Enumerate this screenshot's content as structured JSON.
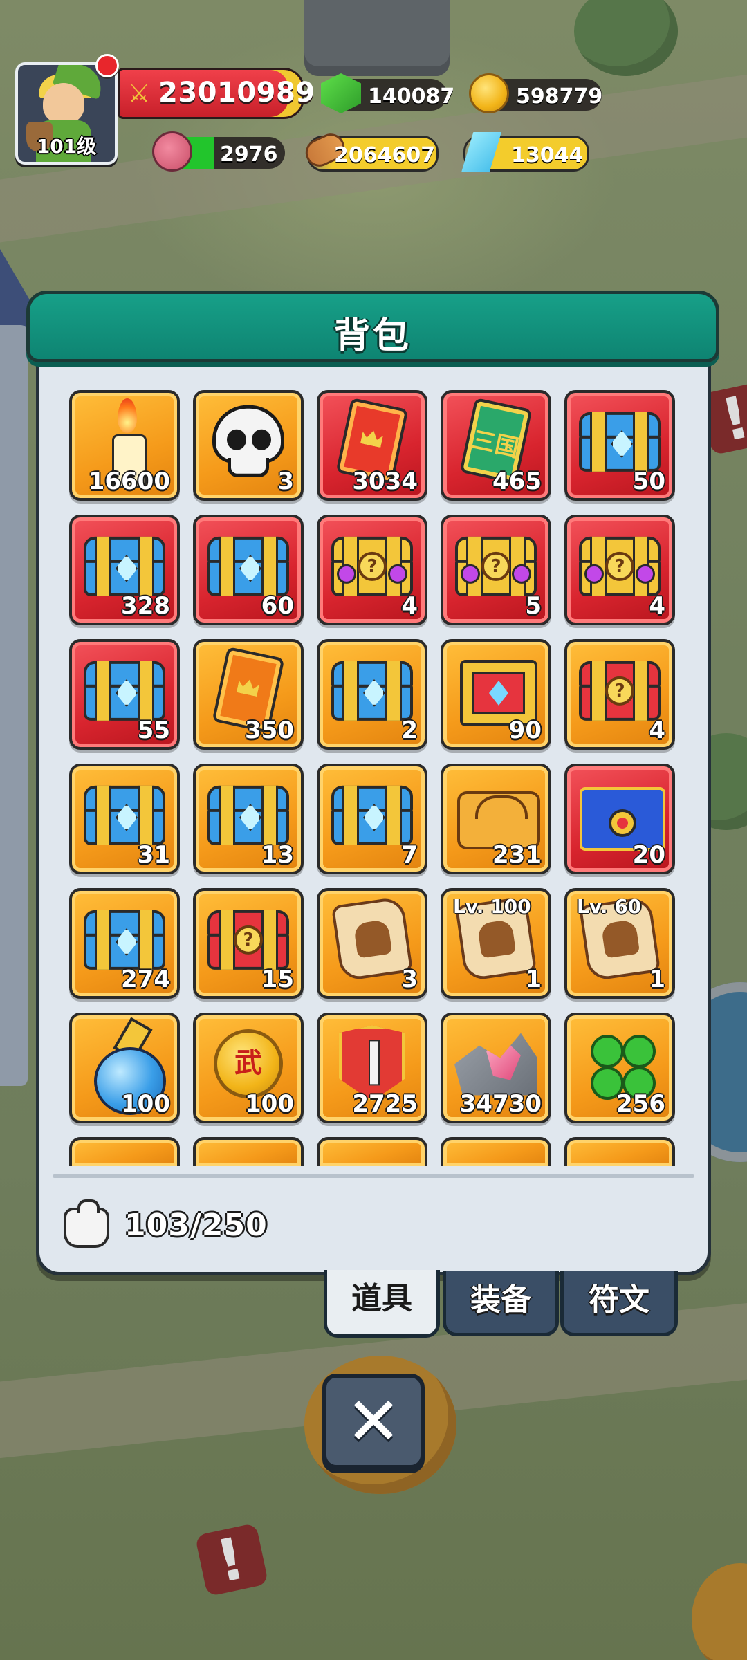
{
  "hud": {
    "level": "101级",
    "power": "23010989",
    "gems": "140087",
    "gold": "598779",
    "meat": "2976",
    "wood": "2064607",
    "crystal": "13044"
  },
  "bag": {
    "title": "背包",
    "capacity": "103/250",
    "items": [
      {
        "icon": "candle-icon",
        "qty": "16600",
        "bg": "orange"
      },
      {
        "icon": "skull-icon",
        "qty": "3",
        "bg": "orange"
      },
      {
        "icon": "red-card-icon",
        "qty": "3034",
        "bg": "red"
      },
      {
        "icon": "green-card-icon",
        "qty": "465",
        "bg": "red"
      },
      {
        "icon": "blue-chest-icon",
        "qty": "50",
        "bg": "red"
      },
      {
        "icon": "blue-chest-icon",
        "qty": "328",
        "bg": "red"
      },
      {
        "icon": "blue-chest-icon",
        "qty": "60",
        "bg": "red"
      },
      {
        "icon": "mystery-chest-icon",
        "qty": "4",
        "bg": "red"
      },
      {
        "icon": "mystery-chest-icon",
        "qty": "5",
        "bg": "red"
      },
      {
        "icon": "mystery-chest-icon",
        "qty": "4",
        "bg": "red"
      },
      {
        "icon": "blue-chest-icon",
        "qty": "55",
        "bg": "red"
      },
      {
        "icon": "orange-card-icon",
        "qty": "350",
        "bg": "orange"
      },
      {
        "icon": "blue-chest-icon",
        "qty": "2",
        "bg": "orange"
      },
      {
        "icon": "red-gold-chest-icon",
        "qty": "90",
        "bg": "orange"
      },
      {
        "icon": "red-mystery-chest-icon",
        "qty": "4",
        "bg": "orange"
      },
      {
        "icon": "blue-chest-icon",
        "qty": "31",
        "bg": "orange"
      },
      {
        "icon": "blue-chest-icon",
        "qty": "13",
        "bg": "orange"
      },
      {
        "icon": "blue-chest-icon",
        "qty": "7",
        "bg": "orange"
      },
      {
        "icon": "gold-chest-icon",
        "qty": "231",
        "bg": "orange"
      },
      {
        "icon": "royal-chest-icon",
        "qty": "20",
        "bg": "red"
      },
      {
        "icon": "blue-chest-icon",
        "qty": "274",
        "bg": "orange"
      },
      {
        "icon": "red-mystery-chest-icon",
        "qty": "15",
        "bg": "orange"
      },
      {
        "icon": "hero-scroll-icon",
        "qty": "3",
        "bg": "orange"
      },
      {
        "icon": "boots-scroll-icon",
        "qty": "1",
        "bg": "orange",
        "level": "Lv. 100"
      },
      {
        "icon": "boots-scroll-icon",
        "qty": "1",
        "bg": "orange",
        "level": "Lv. 60"
      },
      {
        "icon": "potion-icon",
        "qty": "100",
        "bg": "orange"
      },
      {
        "icon": "wu-coin-icon",
        "qty": "100",
        "bg": "orange",
        "glyph": "武"
      },
      {
        "icon": "sword-badge-icon",
        "qty": "2725",
        "bg": "orange"
      },
      {
        "icon": "ore-icon",
        "qty": "34730",
        "bg": "orange"
      },
      {
        "icon": "clover-icon",
        "qty": "256",
        "bg": "orange"
      }
    ],
    "card_glyph": "三国"
  },
  "tabs": [
    {
      "label": "道具",
      "active": true
    },
    {
      "label": "装备",
      "active": false
    },
    {
      "label": "符文",
      "active": false
    }
  ],
  "close_glyph": "✕"
}
